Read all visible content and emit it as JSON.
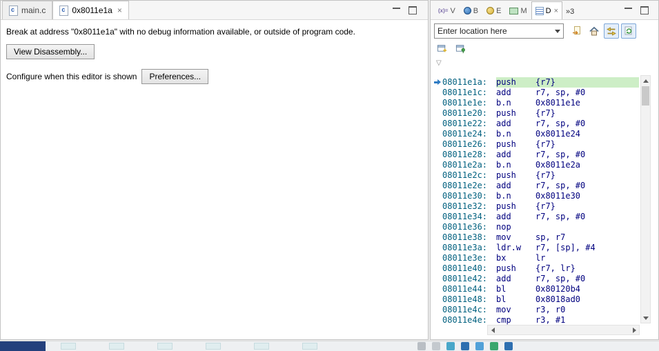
{
  "editor": {
    "tabs": [
      {
        "label": "main.c"
      },
      {
        "label": "0x8011e1a"
      }
    ],
    "message": "Break at address \"0x8011e1a\" with no debug information available, or outside of program code.",
    "view_disassembly_label": "View Disassembly...",
    "configure_label": "Configure when this editor is shown",
    "preferences_label": "Preferences..."
  },
  "debug_panel": {
    "tabs": [
      {
        "label": "V",
        "icon": "variables-icon",
        "icon_text": "(x)="
      },
      {
        "label": "B",
        "icon": "breakpoints-icon"
      },
      {
        "label": "E",
        "icon": "expressions-icon"
      },
      {
        "label": "M",
        "icon": "memory-icon"
      },
      {
        "label": "D",
        "icon": "disassembly-icon"
      }
    ],
    "overflow_label": "»3",
    "location_placeholder": "Enter location here"
  },
  "disassembly": {
    "lines": [
      {
        "address": "08011e1a:",
        "mnemonic": "push",
        "operands": "{r7}",
        "current": true
      },
      {
        "address": "08011e1c:",
        "mnemonic": "add",
        "operands": "r7, sp, #0"
      },
      {
        "address": "08011e1e:",
        "mnemonic": "b.n",
        "operands": "0x8011e1e"
      },
      {
        "address": "08011e20:",
        "mnemonic": "push",
        "operands": "{r7}"
      },
      {
        "address": "08011e22:",
        "mnemonic": "add",
        "operands": "r7, sp, #0"
      },
      {
        "address": "08011e24:",
        "mnemonic": "b.n",
        "operands": "0x8011e24"
      },
      {
        "address": "08011e26:",
        "mnemonic": "push",
        "operands": "{r7}"
      },
      {
        "address": "08011e28:",
        "mnemonic": "add",
        "operands": "r7, sp, #0"
      },
      {
        "address": "08011e2a:",
        "mnemonic": "b.n",
        "operands": "0x8011e2a"
      },
      {
        "address": "08011e2c:",
        "mnemonic": "push",
        "operands": "{r7}"
      },
      {
        "address": "08011e2e:",
        "mnemonic": "add",
        "operands": "r7, sp, #0"
      },
      {
        "address": "08011e30:",
        "mnemonic": "b.n",
        "operands": "0x8011e30"
      },
      {
        "address": "08011e32:",
        "mnemonic": "push",
        "operands": "{r7}"
      },
      {
        "address": "08011e34:",
        "mnemonic": "add",
        "operands": "r7, sp, #0"
      },
      {
        "address": "08011e36:",
        "mnemonic": "nop",
        "operands": ""
      },
      {
        "address": "08011e38:",
        "mnemonic": "mov",
        "operands": "sp, r7"
      },
      {
        "address": "08011e3a:",
        "mnemonic": "ldr.w",
        "operands": "r7, [sp], #4"
      },
      {
        "address": "08011e3e:",
        "mnemonic": "bx",
        "operands": "lr"
      },
      {
        "address": "08011e40:",
        "mnemonic": "push",
        "operands": "{r7, lr}"
      },
      {
        "address": "08011e42:",
        "mnemonic": "add",
        "operands": "r7, sp, #0"
      },
      {
        "address": "08011e44:",
        "mnemonic": "bl",
        "operands": "0x80120b4"
      },
      {
        "address": "08011e48:",
        "mnemonic": "bl",
        "operands": "0x8018ad0"
      },
      {
        "address": "08011e4c:",
        "mnemonic": "mov",
        "operands": "r3, r0"
      },
      {
        "address": "08011e4e:",
        "mnemonic": "cmp",
        "operands": "r3, #1"
      }
    ]
  },
  "colors": {
    "address": "#00607f",
    "code": "#00007f",
    "current_line_bg": "#cdeec6",
    "pointer_arrow": "#2f7cc4"
  },
  "taskbar": {
    "active_item": "taskbar-active-window",
    "app_buttons": [
      "taskbar-app-1",
      "taskbar-app-2",
      "taskbar-app-3",
      "taskbar-app-4",
      "taskbar-app-5",
      "taskbar-app-6"
    ],
    "tray_icons": [
      "tray-icon-1",
      "tray-icon-2",
      "tray-icon-3",
      "tray-icon-4",
      "tray-icon-5",
      "tray-icon-6",
      "tray-icon-7"
    ]
  }
}
